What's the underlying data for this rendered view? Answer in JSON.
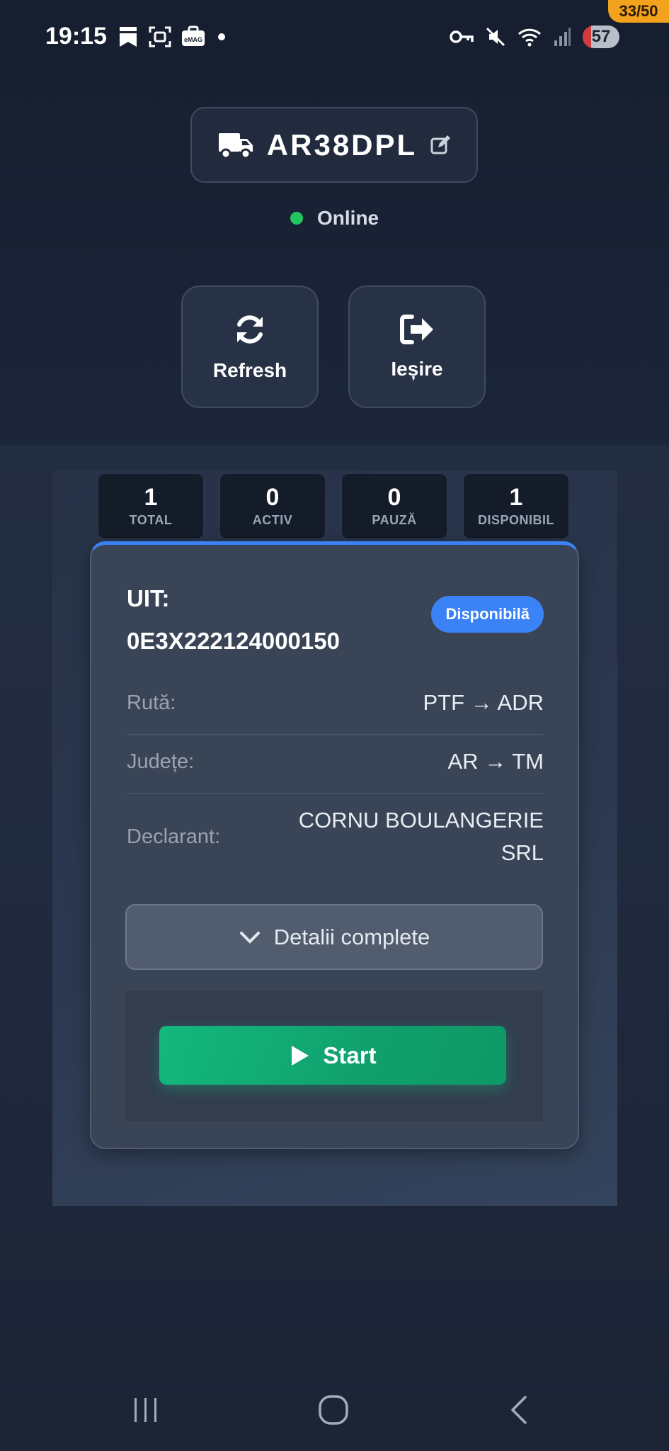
{
  "status_bar": {
    "time": "19:15",
    "battery_level": "57",
    "left_icons": [
      "bookmark-icon",
      "screenshot-icon",
      "emag-app-icon",
      "notification-dot-icon"
    ],
    "right_icons": [
      "vpn-key-icon",
      "mute-icon",
      "wifi-icon",
      "signal-icon",
      "battery-icon"
    ]
  },
  "counter_badge": "33/50",
  "vehicle": {
    "plate": "AR38DPL",
    "status": "Online",
    "status_color": "#22c55e"
  },
  "actions": {
    "refresh_label": "Refresh",
    "exit_label": "Ieșire"
  },
  "stats": [
    {
      "value": "1",
      "label": "TOTAL"
    },
    {
      "value": "0",
      "label": "ACTIV"
    },
    {
      "value": "0",
      "label": "PAUZĂ"
    },
    {
      "value": "1",
      "label": "DISPONIBIL"
    }
  ],
  "card": {
    "uit_label": "UIT:",
    "uit_code": "0E3X222124000150",
    "badge": "Disponibilă",
    "accent_color": "#3b82f6",
    "rows": [
      {
        "label": "Rută:",
        "value": "PTF → ADR"
      },
      {
        "label": "Județe:",
        "value": "AR → TM"
      },
      {
        "label": "Declarant:",
        "value_line1": "CORNU BOULANGERIE",
        "value_line2": "SRL"
      }
    ],
    "details_label": "Detalii complete",
    "start_label": "Start"
  },
  "colors": {
    "start_button": "#10b981",
    "background": "#1c2538"
  },
  "nav_bar": [
    "recents-icon",
    "home-icon",
    "back-icon"
  ]
}
